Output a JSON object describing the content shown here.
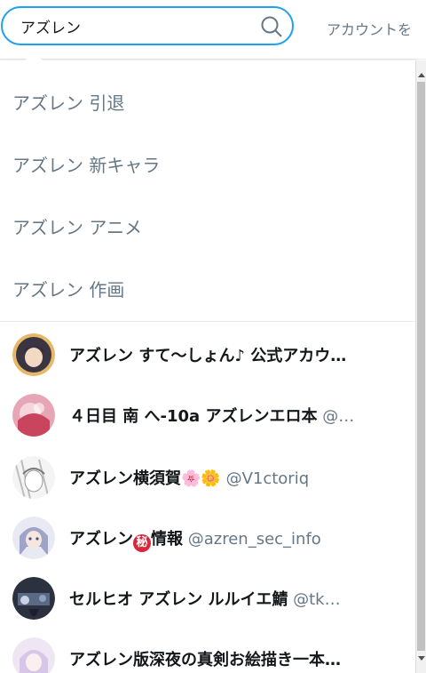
{
  "search": {
    "value": "アズレン",
    "account_link": "アカウントを"
  },
  "topics": [
    {
      "label": "アズレン 引退"
    },
    {
      "label": "アズレン 新キャラ"
    },
    {
      "label": "アズレン アニメ"
    },
    {
      "label": "アズレン 作画"
    }
  ],
  "users": [
    {
      "name": "アズレン すて〜しょん♪ 公式アカウ…",
      "handle": ""
    },
    {
      "name": "４日目 南 へ-10a アズレンエロ本",
      "handle": "@…"
    },
    {
      "name": "アズレン横須賀🌸🌼",
      "handle": "@V1ctoriq"
    },
    {
      "name_pre": "アズレン",
      "badge": "秘",
      "name_post": "情報",
      "handle": "@azren_sec_info"
    },
    {
      "name": "セルヒオ アズレン ルルイエ鯖",
      "handle": "@tk…"
    },
    {
      "name": "アズレン版深夜の真剣お絵描き一本…",
      "handle": ""
    }
  ],
  "colors": {
    "accent": "#1da1f2",
    "secondary_text": "#657786",
    "badge": "#d9263b"
  }
}
